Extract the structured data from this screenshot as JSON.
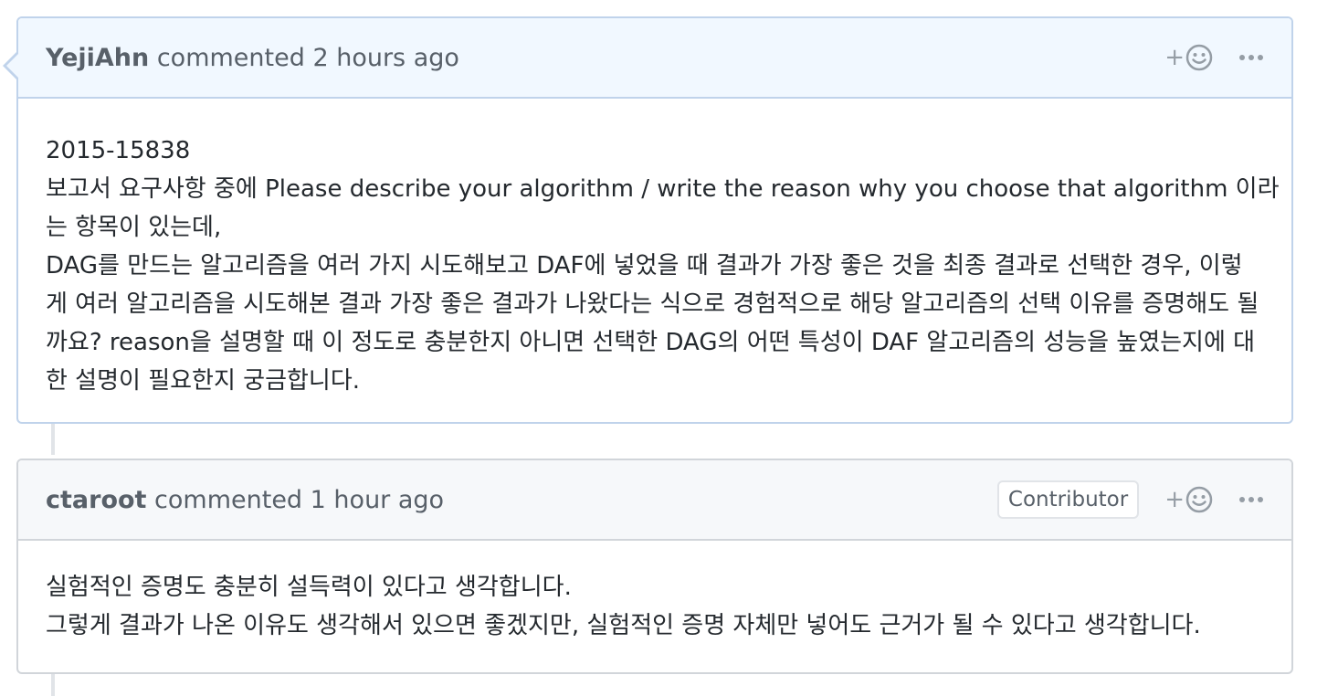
{
  "comments": [
    {
      "author": "YejiAhn",
      "action": "commented",
      "time": "2 hours ago",
      "reaction_plus": "+",
      "icons": {
        "reaction": "smiley-icon",
        "menu": "kebab-horizontal-icon"
      },
      "body_lines": [
        "2015-15838",
        "보고서 요구사항 중에 Please describe your algorithm / write the reason why you choose that algorithm 이라",
        "는 항목이 있는데,",
        "DAG를 만드는 알고리즘을 여러 가지 시도해보고 DAF에 넣었을 때 결과가 가장 좋은 것을 최종 결과로 선택한 경우, 이렇",
        "게 여러 알고리즘을 시도해본 결과 가장 좋은 결과가 나왔다는 식으로 경험적으로 해당 알고리즘의 선택 이유를 증명해도 될",
        "까요? reason을 설명할 때 이 정도로 충분한지 아니면 선택한 DAG의 어떤 특성이 DAF 알고리즘의 성능을 높였는지에 대",
        "한 설명이 필요한지 궁금합니다."
      ]
    },
    {
      "author": "ctaroot",
      "action": "commented",
      "time": "1 hour ago",
      "badge": "Contributor",
      "reaction_plus": "+",
      "icons": {
        "reaction": "smiley-icon",
        "menu": "kebab-horizontal-icon"
      },
      "body_lines": [
        "실험적인 증명도 충분히 설득력이 있다고 생각합니다.",
        "그렇게 결과가 나온 이유도 생각해서 있으면 좋겠지만, 실험적인 증명 자체만 넣어도 근거가 될 수 있다고 생각합니다."
      ]
    }
  ],
  "colors": {
    "header_highlight": "#f1f8ff",
    "border_highlight": "#c0d3eb",
    "header_default": "#f6f8fa",
    "border_default": "#d1d5da"
  }
}
